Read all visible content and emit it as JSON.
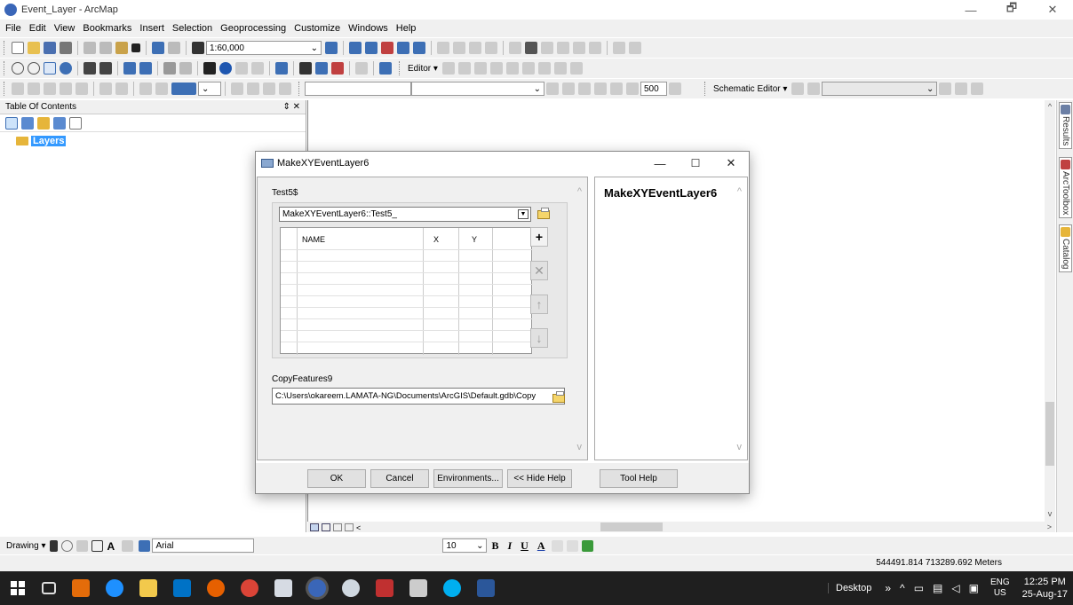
{
  "window": {
    "title": "Event_Layer - ArcMap",
    "min": "—",
    "max": "🗗",
    "close": "✕"
  },
  "menu": [
    "File",
    "Edit",
    "View",
    "Bookmarks",
    "Insert",
    "Selection",
    "Geoprocessing",
    "Customize",
    "Windows",
    "Help"
  ],
  "toolbar": {
    "scale": "1:60,000",
    "editor_label": "Editor ▾",
    "display_value": "500",
    "schematic_label": "Schematic Editor ▾"
  },
  "toc": {
    "title": "Table Of Contents",
    "pin": "⇕ ✕",
    "layers_label": "Layers"
  },
  "side_tabs": [
    "Results",
    "ArcToolbox",
    "Catalog"
  ],
  "drawing": {
    "label": "Drawing ▾",
    "font_name": "Arial",
    "font_size": "10"
  },
  "status": {
    "coordinates": "544491.814  713289.692 Meters"
  },
  "dialog": {
    "title": "MakeXYEventLayer6",
    "test_label": "Test5$",
    "dropdown_value": "MakeXYEventLayer6::Test5_",
    "columns": {
      "name": "NAME",
      "x": "X",
      "y": "Y"
    },
    "add": "+",
    "remove": "✕",
    "up": "↑",
    "down": "↓",
    "copy_label": "CopyFeatures9",
    "output_path": "C:\\Users\\okareem.LAMATA-NG\\Documents\\ArcGIS\\Default.gdb\\Copy",
    "help_title": "MakeXYEventLayer6",
    "scroll_up": "^",
    "scroll_down": "v",
    "buttons": {
      "ok": "OK",
      "cancel": "Cancel",
      "environments": "Environments...",
      "hide_help": "<< Hide Help",
      "tool_help": "Tool Help"
    }
  },
  "taskbar": {
    "desktop": "Desktop",
    "lang": "ENG",
    "region": "US",
    "time": "12:25 PM",
    "date": "25-Aug-17"
  },
  "colors": {
    "selected": "#3399ff",
    "taskbar": "#1f1f1f",
    "chrome": "#f0f0f0"
  }
}
